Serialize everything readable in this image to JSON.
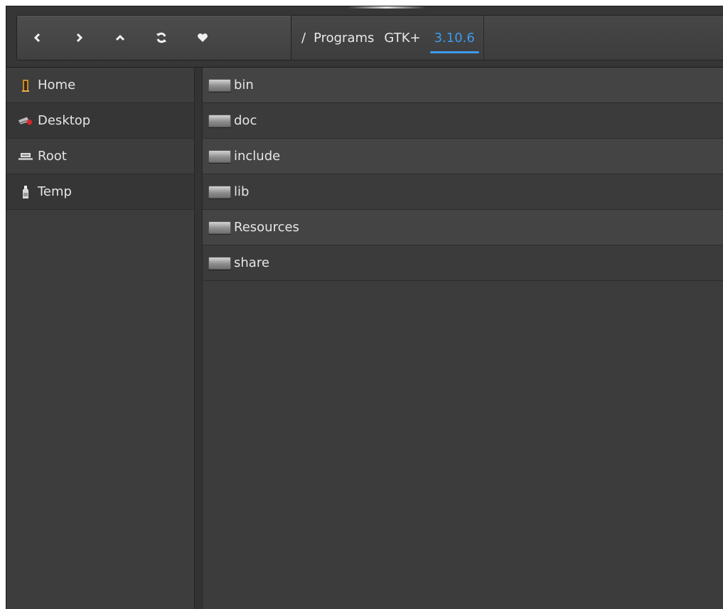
{
  "toolbar": {
    "nav_buttons": [
      "back",
      "forward",
      "up",
      "refresh",
      "favorite"
    ]
  },
  "breadcrumb": {
    "separator": "/",
    "items": [
      "Programs",
      "GTK+",
      "3.10.6"
    ],
    "active_color": "#3d9bef"
  },
  "sidebar": {
    "items": [
      {
        "label": "Home",
        "icon": "home-icon"
      },
      {
        "label": "Desktop",
        "icon": "desktop-icon"
      },
      {
        "label": "Root",
        "icon": "root-drive-icon"
      },
      {
        "label": "Temp",
        "icon": "temp-bottle-icon"
      }
    ]
  },
  "files": {
    "items": [
      "bin",
      "doc",
      "include",
      "lib",
      "Resources",
      "share"
    ]
  }
}
